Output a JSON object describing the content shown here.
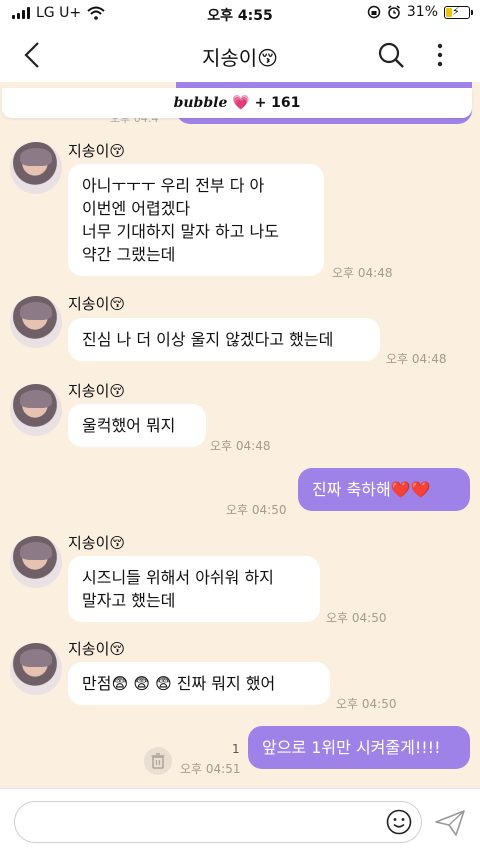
{
  "status_bar": {
    "carrier": "LG U+",
    "time": "오후 4:55",
    "battery_percent": "31%",
    "battery_level": 0.31,
    "icons": [
      "signal-icon",
      "wifi-icon",
      "screen-lock-icon",
      "alarm-icon",
      "battery-icon"
    ]
  },
  "header": {
    "title": "지송이😚",
    "icons": [
      "back-arrow-icon",
      "search-icon",
      "more-vertical-icon"
    ]
  },
  "banner": {
    "brand": "bubble",
    "heart": "💗",
    "count": "+ 161"
  },
  "chat": {
    "prev_time": "오후 04:4",
    "messages": [
      {
        "type": "in",
        "sender": "지송이😚",
        "text": "아니ㅜㅜㅜ 우리 전부 다 아\n이번엔 어렵겠다\n너무 기대하지 말자 하고 나도\n약간 그랬는데",
        "time": "오후 04:48"
      },
      {
        "type": "in",
        "sender": "지송이😚",
        "text": "진심 나 더 이상 울지 않겠다고 했는데",
        "time": "오후 04:48"
      },
      {
        "type": "in",
        "sender": "지송이😚",
        "text": "울컥했어 뭐지",
        "time": "오후 04:48"
      },
      {
        "type": "out",
        "text": "진짜 축하해❤️❤️",
        "time": "오후 04:50"
      },
      {
        "type": "in",
        "sender": "지송이😚",
        "text": "시즈니들 위해서 아쉬워 하지\n말자고 했는데",
        "time": "오후 04:50"
      },
      {
        "type": "in",
        "sender": "지송이😚",
        "text": "만점😨 😨 😨 진짜 뭐지 했어",
        "time": "오후 04:50"
      },
      {
        "type": "out",
        "text": "앞으로 1위만 시켜줄게!!!!",
        "time": "오후 04:51",
        "unread": "1"
      }
    ]
  },
  "input": {
    "placeholder": "",
    "icons": [
      "emoji-icon",
      "send-icon",
      "trash-icon"
    ]
  },
  "colors": {
    "chat_background": "#fbefdf",
    "outgoing_bubble": "#9f82e8",
    "incoming_bubble": "#ffffff",
    "battery_fill": "#f2c20b",
    "heart": "#e8409e"
  }
}
